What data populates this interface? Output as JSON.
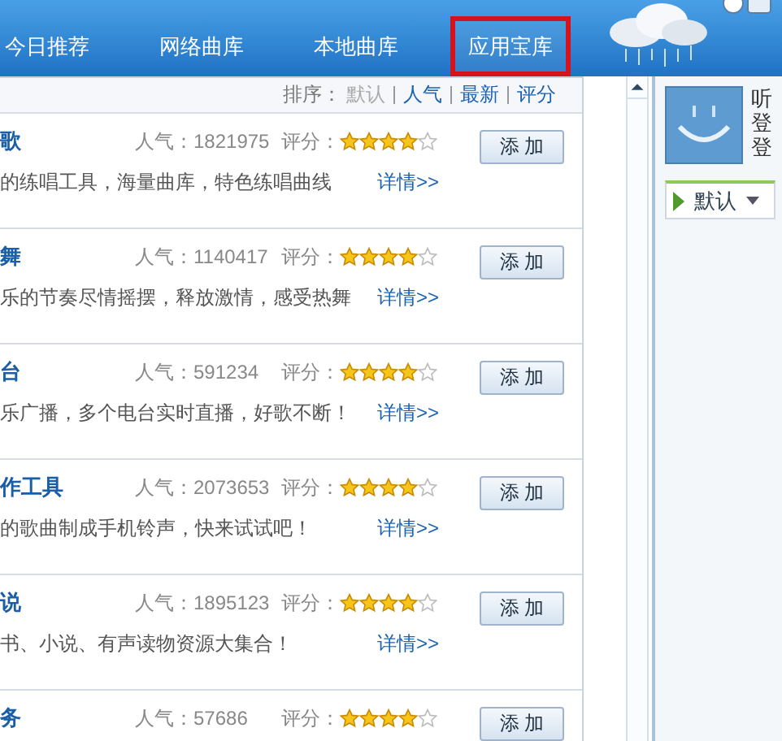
{
  "nav": {
    "tabs": [
      {
        "label": "今日推荐",
        "selected": false
      },
      {
        "label": "网络曲库",
        "selected": false
      },
      {
        "label": "本地曲库",
        "selected": false
      },
      {
        "label": "应用宝库",
        "selected": true
      }
    ]
  },
  "sort": {
    "label": "排序：",
    "options": [
      {
        "label": "默认",
        "selected": true
      },
      {
        "label": "人气",
        "selected": false
      },
      {
        "label": "最新",
        "selected": false
      },
      {
        "label": "评分",
        "selected": false
      }
    ]
  },
  "apps": [
    {
      "title": "歌",
      "popularity": "人气：1821975",
      "score_label": "评分：",
      "stars": 4,
      "description": "的练唱工具，海量曲库，特色练唱曲线",
      "details": "详情>>",
      "button": "添 加"
    },
    {
      "title": "舞",
      "popularity": "人气：1140417",
      "score_label": "评分：",
      "stars": 4,
      "description": "乐的节奏尽情摇摆，释放激情，感受热舞",
      "details": "详情>>",
      "button": "添 加"
    },
    {
      "title": "台",
      "popularity": "人气：591234",
      "score_label": "评分：",
      "stars": 4,
      "description": "乐广播，多个电台实时直播，好歌不断！",
      "details": "详情>>",
      "button": "添 加"
    },
    {
      "title": "作工具",
      "popularity": "人气：2073653",
      "score_label": "评分：",
      "stars": 4,
      "description": "的歌曲制成手机铃声，快来试试吧！",
      "details": "详情>>",
      "button": "添 加"
    },
    {
      "title": "说",
      "popularity": "人气：1895123",
      "score_label": "评分：",
      "stars": 4,
      "description": "书、小说、有声读物资源大集合！",
      "details": "详情>>",
      "button": "添 加"
    },
    {
      "title": "务",
      "popularity": "人气：57686",
      "score_label": "评分：",
      "stars": 4,
      "button": "添 加"
    }
  ],
  "profile": {
    "lines": [
      "听",
      "登",
      "登"
    ]
  },
  "playlist_tab": {
    "label": "默认"
  }
}
